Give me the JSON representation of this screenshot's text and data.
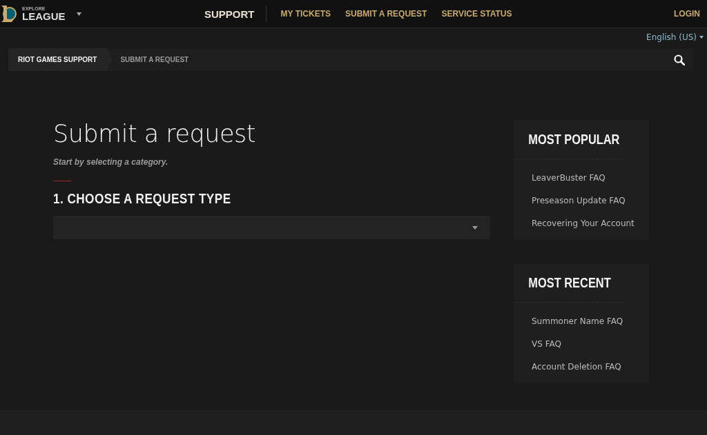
{
  "header": {
    "logo_small": "EXPLORE",
    "logo_large": "LEAGUE",
    "section": "SUPPORT",
    "nav": [
      "MY TICKETS",
      "SUBMIT A REQUEST",
      "SERVICE STATUS"
    ],
    "login": "LOGIN"
  },
  "language": "English (US)",
  "breadcrumb": [
    {
      "label": "RIOT GAMES SUPPORT",
      "current": false
    },
    {
      "label": "SUBMIT A REQUEST",
      "current": true
    }
  ],
  "form": {
    "title": "Submit a request",
    "subtitle": "Start by selecting a category.",
    "step": "1. CHOOSE A REQUEST TYPE"
  },
  "panels": [
    {
      "title": "MOST POPULAR",
      "links": [
        "LeaverBuster FAQ",
        "Preseason Update FAQ",
        "Recovering Your Account"
      ]
    },
    {
      "title": "MOST RECENT",
      "links": [
        "Summoner Name FAQ",
        "VS FAQ",
        "Account Deletion FAQ"
      ]
    }
  ]
}
